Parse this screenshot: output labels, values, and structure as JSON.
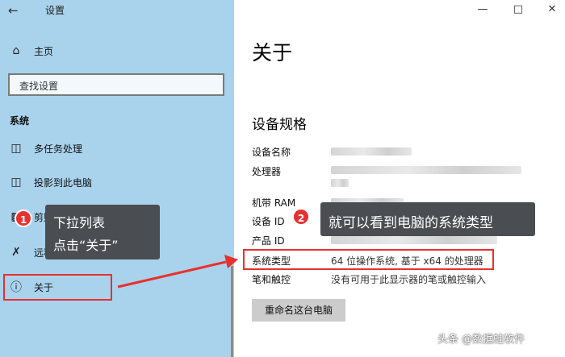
{
  "window": {
    "title": "设置"
  },
  "sidebar": {
    "home_label": "主页",
    "search_placeholder": "查找设置",
    "section_label": "系统",
    "items": [
      {
        "label": "多任务处理",
        "icon": "multitask-icon"
      },
      {
        "label": "投影到此电脑",
        "icon": "project-icon"
      },
      {
        "label": "剪贴板",
        "icon": "clipboard-icon"
      },
      {
        "label": "远程桌面",
        "icon": "remote-desktop-icon"
      },
      {
        "label": "关于",
        "icon": "info-icon"
      }
    ]
  },
  "main": {
    "title": "关于",
    "subtitle": "设备规格",
    "specs": [
      {
        "label": "设备名称",
        "value": ""
      },
      {
        "label": "处理器",
        "value": ""
      },
      {
        "label": "机带 RAM",
        "value": ""
      },
      {
        "label": "设备 ID",
        "value": ""
      },
      {
        "label": "产品 ID",
        "value": ""
      },
      {
        "label": "系统类型",
        "value": "64 位操作系统, 基于 x64 的处理器"
      },
      {
        "label": "笔和触控",
        "value": "没有可用于此显示器的笔或触控输入"
      }
    ],
    "rename_button": "重命名这台电脑"
  },
  "annotations": {
    "step1": {
      "number": "1",
      "line1": "下拉列表",
      "line2": "点击“关于”"
    },
    "step2": {
      "number": "2",
      "text": "就可以看到电脑的系统类型"
    },
    "highlight_color": "#e8302f"
  },
  "watermark": "头条 @数据蛙软件"
}
